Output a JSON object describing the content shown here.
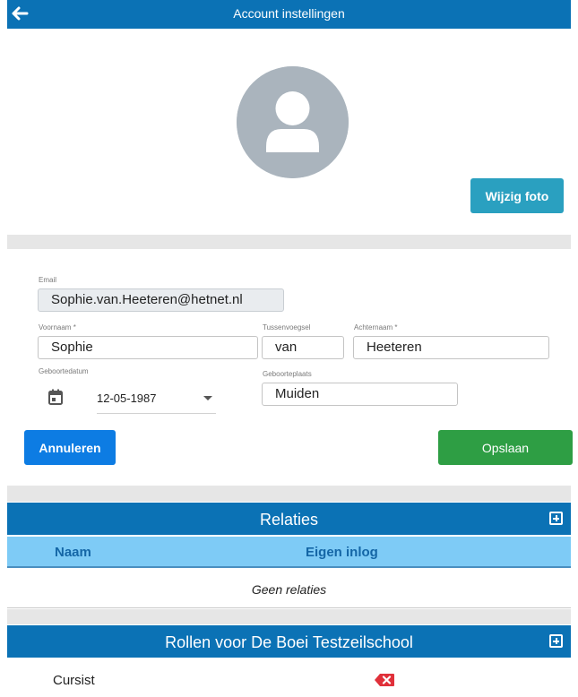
{
  "header": {
    "title": "Account instellingen",
    "back_icon": "arrow-left-icon"
  },
  "photo": {
    "icon": "avatar-placeholder-icon",
    "change_label": "Wijzig foto"
  },
  "form": {
    "email": {
      "label": "Email",
      "value": "Sophie.van.Heeteren@hetnet.nl"
    },
    "first_name": {
      "label": "Voornaam *",
      "value": "Sophie"
    },
    "infix": {
      "label": "Tussenvoegsel",
      "value": "van"
    },
    "last_name": {
      "label": "Achternaam *",
      "value": "Heeteren"
    },
    "birth_date": {
      "label": "Geboortedatum",
      "value": "12-05-1987",
      "icon": "calendar-icon"
    },
    "birth_place": {
      "label": "Geboorteplaats",
      "value": "Muiden"
    },
    "cancel_label": "Annuleren",
    "save_label": "Opslaan"
  },
  "relations": {
    "title": "Relaties",
    "add_icon": "plus-square-icon",
    "columns": [
      "Naam",
      "Eigen inlog"
    ],
    "empty_text": "Geen relaties"
  },
  "roles": {
    "title": "Rollen voor De Boei Testzeilschool",
    "add_icon": "plus-square-icon",
    "items": [
      {
        "name": "Cursist",
        "delete_icon": "delete-x-icon"
      }
    ]
  },
  "colors": {
    "primary": "#0b72b5",
    "info_button": "#2aa0c0",
    "cancel_button": "#0d7ce3",
    "save_button": "#2e9e44",
    "table_header": "#7ecbf6",
    "delete": "#e0303a"
  }
}
